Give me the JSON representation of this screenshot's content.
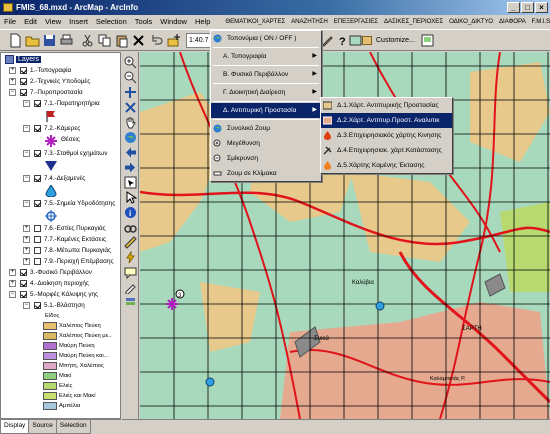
{
  "window": {
    "title": "FMIS_68.mxd - ArcMap - ArcInfo",
    "min": "_",
    "max": "□",
    "close": "×"
  },
  "menubar": {
    "items": [
      "File",
      "Edit",
      "View",
      "Insert",
      "Selection",
      "Tools",
      "Window",
      "Help"
    ],
    "greek_items": [
      "ΘΕΜΑΤΙΚΟΙ_ΧΑΡΤΕΣ",
      "ΑΝΑΖΗΤΗΣΗ",
      "ΕΠΕΞΕΡΓΑΣΙΕΣ",
      "ΔΑΣΙΚΕΣ_ΠΕΡΙΟΧΕΣ",
      "ΟΔΙΚΟ_ΔΙΚΤΥΟ",
      "ΔΙΑΦΟΡΑ",
      "F.M.I.S"
    ]
  },
  "toolbar": {
    "scale": "1:40.7",
    "customize_label": "Customize..."
  },
  "toc": {
    "title": "Layers",
    "groups": [
      {
        "label": "1.-Τοπογραφία"
      },
      {
        "label": "2.-Τεχνικές Υποδομές"
      },
      {
        "label": "7.-Πυροπροστασία"
      }
    ],
    "fire_sublayers": [
      "7.1.-Παρατηρητήρια",
      "7.2.-Κάμερες",
      "7.3.-Σταθμοί εχημάτων",
      "7.4.-Δεξαμενές",
      "7.5.-Σημεία Υδροδότησης",
      "7.6.-Εστίες Πυρκαγιάς",
      "7.7.-Καμένες Εκτάσεις",
      "7.8.-Μέτωπα Πυρκαγιάς",
      "7.9.-Περιοχή Επέμβασης"
    ],
    "camera_symbol_label": "Θέσεις",
    "other_groups": [
      "3.-Φυσικό Περιβάλλον",
      "4.-Διοίκηση περιοχής",
      "5.-Μορφές Κάλυψης γης"
    ],
    "cover_sublayer": "5.1.-Βλάστηση",
    "cover_field": "Είδος",
    "legend": [
      {
        "label": "Χαλέπιος Πεύκη",
        "color": "#e8c070"
      },
      {
        "label": "Χαλέπιος Πεύκη με..",
        "color": "#d8b860"
      },
      {
        "label": "Μαύρη Πεύκη",
        "color": "#b070d0"
      },
      {
        "label": "Μαύρη Πεύκη και...",
        "color": "#c090e0"
      },
      {
        "label": "Μπήτη, Χαλέπιος",
        "color": "#e0a8c8"
      },
      {
        "label": "Μακί",
        "color": "#8fd07e"
      },
      {
        "label": "Ελιές",
        "color": "#b8d870"
      },
      {
        "label": "Ελιές και Μακί",
        "color": "#c8e070"
      },
      {
        "label": "Αμπέλια",
        "color": "#a8c8e0"
      }
    ],
    "tabs": [
      "Display",
      "Source",
      "Selection"
    ]
  },
  "dropdown": {
    "items": [
      {
        "label": "Τοπονύμια ( ON / OFF )",
        "has_arrow": false,
        "icon": "globe-icon"
      },
      {
        "label": "Α. Τοπογραφία",
        "has_arrow": true
      },
      {
        "label": "Β. Φυσικό Περιβάλλον",
        "has_arrow": true
      },
      {
        "label": "Γ. Διοικητική Διαίρεση",
        "has_arrow": true
      },
      {
        "label": "Δ. Αντιπυρική Προστασία",
        "has_arrow": true,
        "selected": true
      },
      {
        "label": "Συνολικό Ζουμ",
        "icon": "globe-icon"
      },
      {
        "label": "Μεγέθυνση",
        "icon": "zoom-in-icon"
      },
      {
        "label": "Σμίκρυνση",
        "icon": "zoom-out-icon"
      },
      {
        "label": "Ζουμ σε Κλίμακα",
        "icon": "scale-icon"
      }
    ]
  },
  "submenu": {
    "items": [
      {
        "label": "Δ.1.Χάρτ. Αντιπυρικής Προστασίας"
      },
      {
        "label": "Δ.2.Χάρτ. Αντιπυρ.Προστ. Αναλυτικ",
        "selected": true
      },
      {
        "label": "Δ.3.Επιχειρησιακός χάρτης Κινησης"
      },
      {
        "label": "Δ.4.Επιχειρησιακ. χάρτ.Κατάστασης"
      },
      {
        "label": "Δ.5.Χάρτης Καμένης Έκτασης"
      }
    ]
  },
  "map": {
    "labels": [
      "Συκιά",
      "Καλύβια",
      "ΣΑΡΤΗ",
      "Καλαμιτσιάς Ρ."
    ],
    "marker_label": "3",
    "colors": {
      "water": "#a9d9bd",
      "tan": "#e8c98c",
      "brown": "#e5a98f",
      "road": "#e0141a",
      "grid": "#000000"
    }
  }
}
